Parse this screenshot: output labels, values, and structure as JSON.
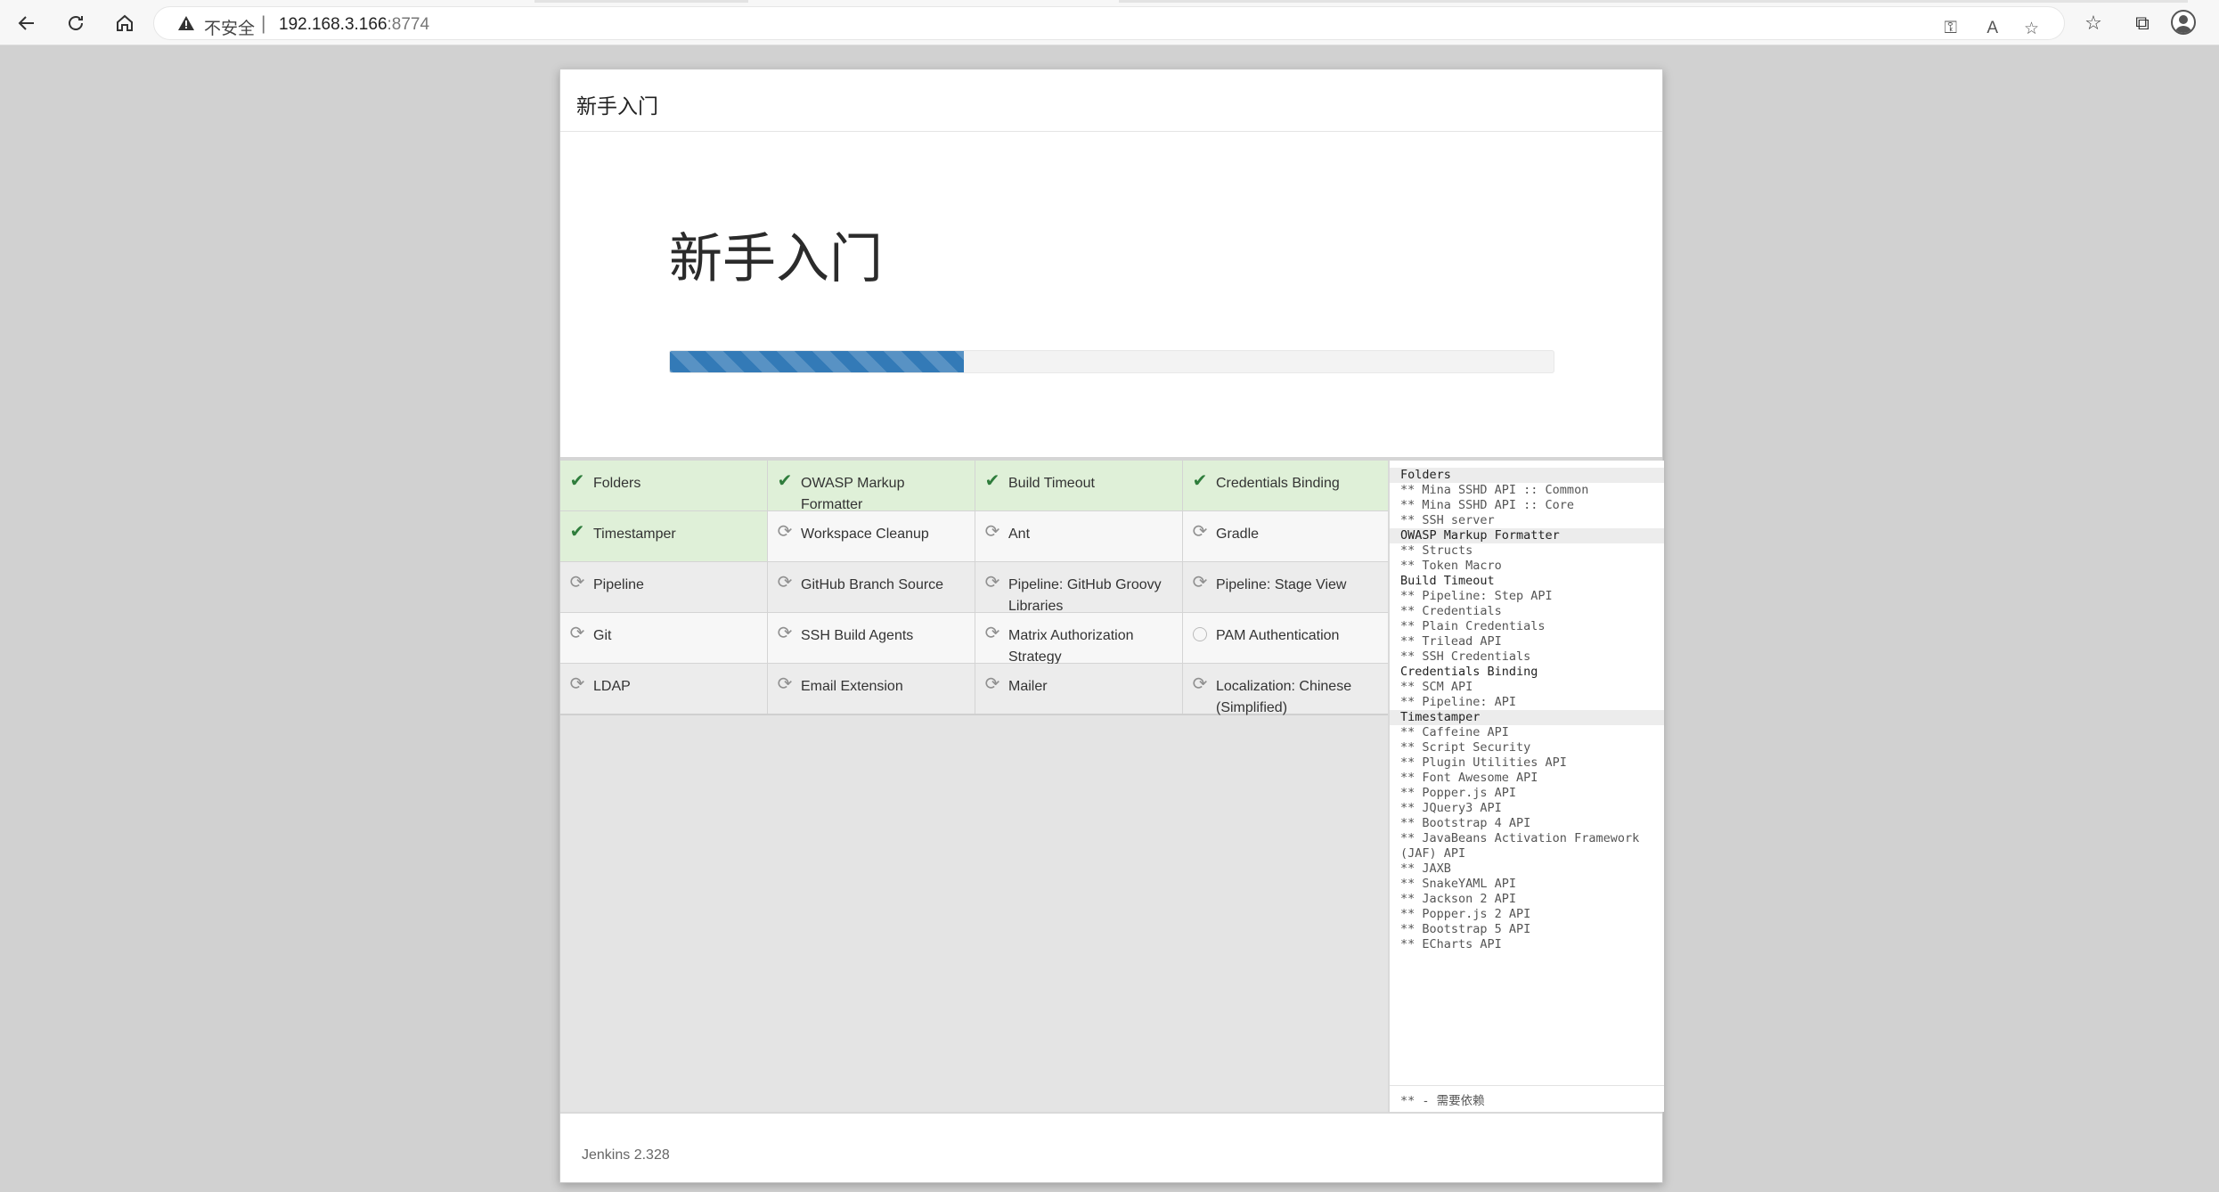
{
  "browser": {
    "security_label": "不安全",
    "separator": "|",
    "url_host": "192.168.3.166",
    "url_port": ":8774"
  },
  "dialog": {
    "header_title": "新手入门",
    "hero_title": "新手入门",
    "progress_fraction": 0.333,
    "progress_color": "#337ab7",
    "footer_version": "Jenkins 2.328"
  },
  "plugins": [
    {
      "name": "Folders",
      "status": "success"
    },
    {
      "name": "OWASP Markup Formatter",
      "status": "success"
    },
    {
      "name": "Build Timeout",
      "status": "success"
    },
    {
      "name": "Credentials Binding",
      "status": "success"
    },
    {
      "name": "Timestamper",
      "status": "success"
    },
    {
      "name": "Workspace Cleanup",
      "status": "installing"
    },
    {
      "name": "Ant",
      "status": "installing"
    },
    {
      "name": "Gradle",
      "status": "installing"
    },
    {
      "name": "Pipeline",
      "status": "installing"
    },
    {
      "name": "GitHub Branch Source",
      "status": "installing"
    },
    {
      "name": "Pipeline: GitHub Groovy Libraries",
      "status": "installing"
    },
    {
      "name": "Pipeline: Stage View",
      "status": "installing"
    },
    {
      "name": "Git",
      "status": "installing"
    },
    {
      "name": "SSH Build Agents",
      "status": "installing"
    },
    {
      "name": "Matrix Authorization Strategy",
      "status": "installing"
    },
    {
      "name": "PAM Authentication",
      "status": "pending"
    },
    {
      "name": "LDAP",
      "status": "installing"
    },
    {
      "name": "Email Extension",
      "status": "installing"
    },
    {
      "name": "Mailer",
      "status": "installing"
    },
    {
      "name": "Localization: Chinese (Simplified)",
      "status": "installing"
    }
  ],
  "log": {
    "lines": [
      {
        "text": "Folders",
        "type": "header",
        "shade": true
      },
      {
        "text": "** Mina SSHD API :: Common",
        "type": "dep"
      },
      {
        "text": "** Mina SSHD API :: Core",
        "type": "dep"
      },
      {
        "text": "** SSH server",
        "type": "dep"
      },
      {
        "text": "OWASP Markup Formatter",
        "type": "header",
        "shade": true
      },
      {
        "text": "** Structs",
        "type": "dep"
      },
      {
        "text": "** Token Macro",
        "type": "dep"
      },
      {
        "text": "Build Timeout",
        "type": "header"
      },
      {
        "text": "** Pipeline: Step API",
        "type": "dep"
      },
      {
        "text": "** Credentials",
        "type": "dep"
      },
      {
        "text": "** Plain Credentials",
        "type": "dep"
      },
      {
        "text": "** Trilead API",
        "type": "dep"
      },
      {
        "text": "** SSH Credentials",
        "type": "dep"
      },
      {
        "text": "Credentials Binding",
        "type": "header"
      },
      {
        "text": "** SCM API",
        "type": "dep"
      },
      {
        "text": "** Pipeline: API",
        "type": "dep"
      },
      {
        "text": "Timestamper",
        "type": "header",
        "shade": true
      },
      {
        "text": "** Caffeine API",
        "type": "dep"
      },
      {
        "text": "** Script Security",
        "type": "dep"
      },
      {
        "text": "** Plugin Utilities API",
        "type": "dep"
      },
      {
        "text": "** Font Awesome API",
        "type": "dep"
      },
      {
        "text": "** Popper.js API",
        "type": "dep"
      },
      {
        "text": "** JQuery3 API",
        "type": "dep"
      },
      {
        "text": "** Bootstrap 4 API",
        "type": "dep"
      },
      {
        "text": "** JavaBeans Activation Framework (JAF) API",
        "type": "dep"
      },
      {
        "text": "** JAXB",
        "type": "dep"
      },
      {
        "text": "** SnakeYAML API",
        "type": "dep"
      },
      {
        "text": "** Jackson 2 API",
        "type": "dep"
      },
      {
        "text": "** Popper.js 2 API",
        "type": "dep"
      },
      {
        "text": "** Bootstrap 5 API",
        "type": "dep"
      },
      {
        "text": "** ECharts API",
        "type": "dep"
      }
    ],
    "footer": "** - 需要依赖"
  },
  "icons": {
    "back": "back-arrow-icon",
    "reload": "reload-icon",
    "home": "home-icon",
    "warning": "warning-triangle-icon",
    "check": "checkmark-icon",
    "installing": "sync-icon",
    "pending": "empty-circle-icon"
  }
}
